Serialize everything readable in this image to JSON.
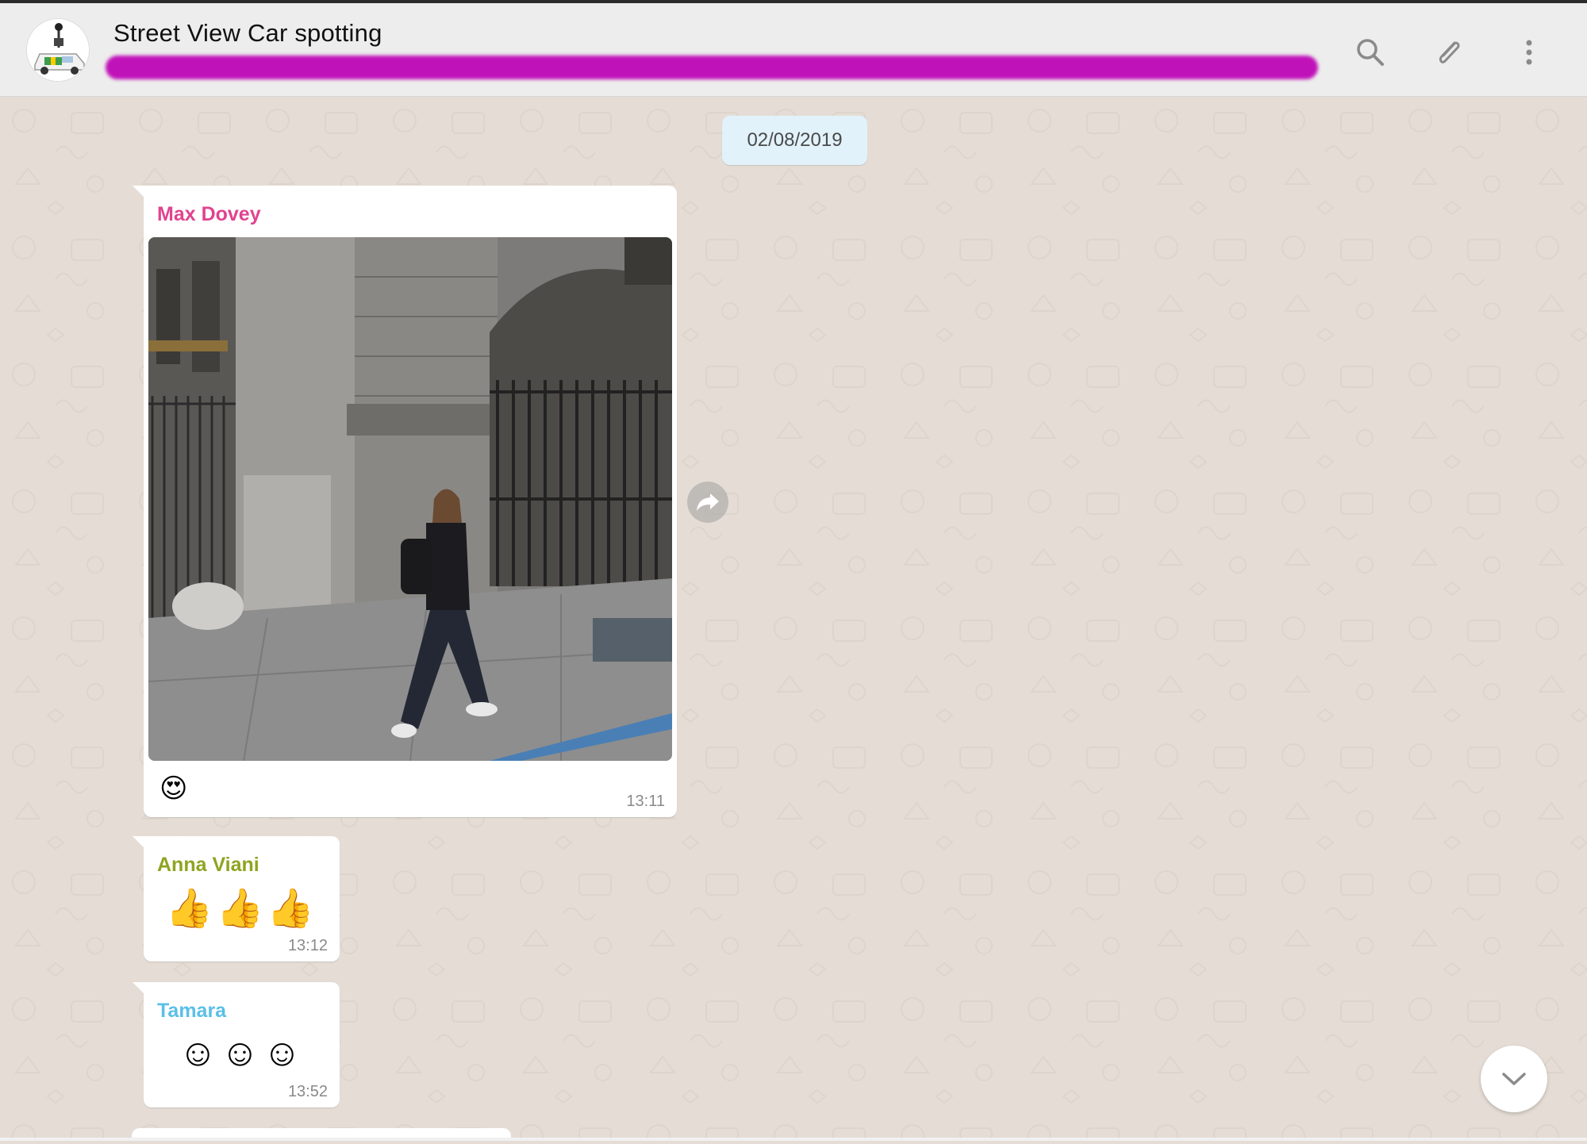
{
  "header": {
    "title": "Street View Car spotting",
    "subtitle_redacted": true,
    "icons": [
      "search-icon",
      "paperclip-icon",
      "menu-dots-icon"
    ]
  },
  "chat": {
    "date_label": "02/08/2019",
    "messages": [
      {
        "sender": "Max Dovey",
        "sender_color": "#e0438f",
        "type": "image",
        "caption_emoji": "😍",
        "time": "13:11"
      },
      {
        "sender": "Anna Viani",
        "sender_color": "#8ea421",
        "type": "text",
        "text": "👍👍👍",
        "time": "13:12"
      },
      {
        "sender": "Tamara",
        "sender_color": "#5bbfe8",
        "type": "text",
        "text": "☺☺☺",
        "time": "13:52"
      }
    ]
  },
  "colors": {
    "chat_background": "#e5ddd5",
    "header_background": "#ededed",
    "bubble": "#ffffff",
    "date_pill": "#e1f2fb"
  }
}
